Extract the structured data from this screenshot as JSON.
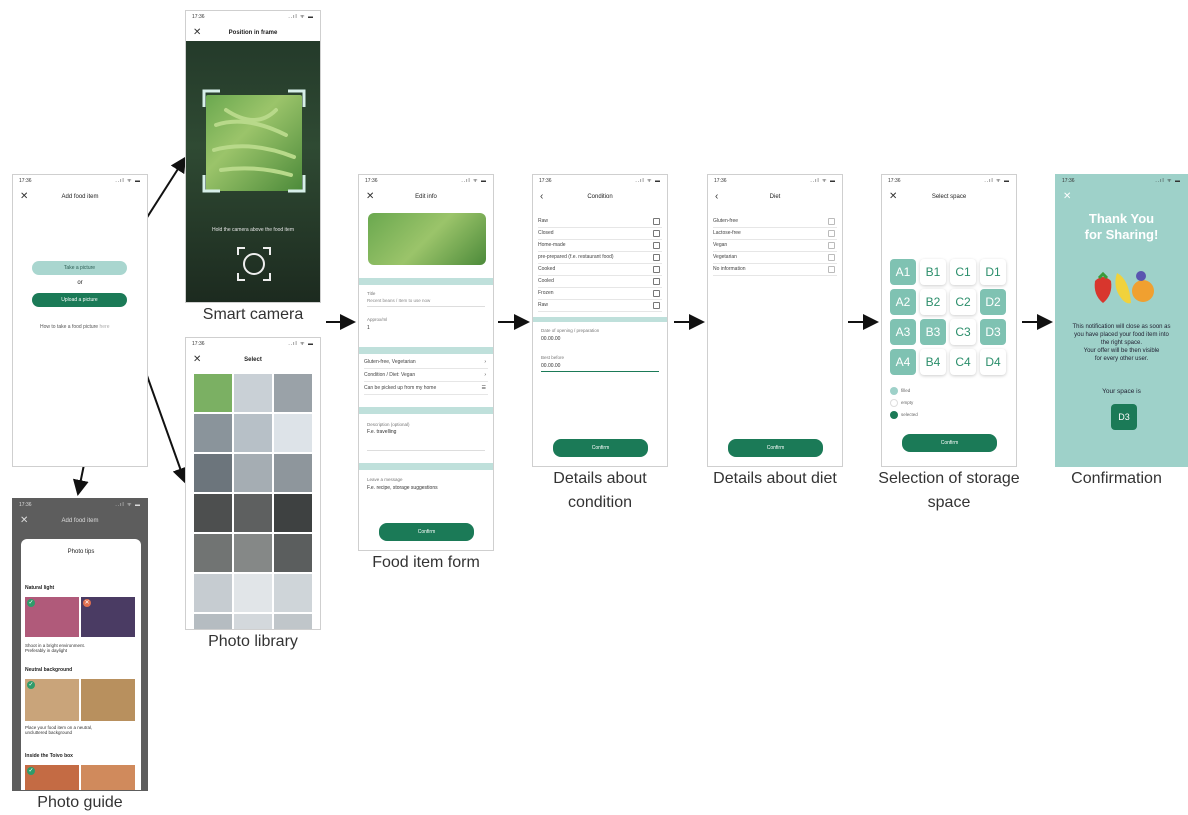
{
  "captions": {
    "smart_camera": "Smart camera",
    "photo_library": "Photo library",
    "photo_guide": "Photo guide",
    "food_form": "Food item form",
    "condition": "Details about condition",
    "diet": "Details about diet",
    "storage": "Selection of storage space",
    "confirmation": "Confirmation"
  },
  "status_time": "17:36",
  "status_icons": "..ıl ᯤ ▬",
  "add_food": {
    "title": "Add food item",
    "take_picture": "Take a picture",
    "or": "or",
    "upload": "Upload a picture",
    "howto": "How to take a food picture",
    "howto_link": "here"
  },
  "camera": {
    "title": "Position in frame",
    "hint": "Hold the camera above the food item"
  },
  "library": {
    "title": "Select"
  },
  "guide": {
    "bg_title": "Add food item",
    "card_title": "Photo tips",
    "s1": "Natural light",
    "s1_text1": "Shoot in a bright environment.",
    "s1_text2": "Preferably in daylight",
    "s2": "Neutral background",
    "s2_text1": "Place your food item on a neutral,",
    "s2_text2": "uncluttered background",
    "s3": "Inside the Toivo box"
  },
  "form": {
    "title": "Edit info",
    "title_label": "Title",
    "title_placeholder": "Recent beans / Item to use now",
    "amount_label": "Approx/ml",
    "amount_value": "1",
    "diet1": "Gluten-free, Vegetarian",
    "diet2": "Condition / Diet: Vegan",
    "pickup": "Can be picked up from my home",
    "desc_label": "Description (optional)",
    "desc_value": "F.e. travelling",
    "msg_label": "Leave a message",
    "msg_value": "F.e. recipe, storage suggestions",
    "confirm": "Confirm"
  },
  "condition": {
    "title": "Condition",
    "items": [
      "Raw",
      "Closed",
      "Home-made",
      "pre-prepared (f.e. restaurant food)",
      "Cooked",
      "Cooled",
      "Frozen",
      "Raw"
    ],
    "date_label": "Date of opening / preparation",
    "date_value": "00.00.00",
    "best_label": "Best before",
    "best_value": "00.00.00",
    "confirm": "Confirm"
  },
  "diet": {
    "title": "Diet",
    "items": [
      "Gluten-free",
      "Lactose-free",
      "Vegan",
      "Vegetarian",
      "No information"
    ],
    "confirm": "Confirm"
  },
  "storage": {
    "title": "Select space",
    "rows": [
      [
        "A1",
        "B1",
        "C1",
        "D1"
      ],
      [
        "A2",
        "B2",
        "C2",
        "D2"
      ],
      [
        "A3",
        "B3",
        "C3",
        "D3"
      ],
      [
        "A4",
        "B4",
        "C4",
        "D4"
      ]
    ],
    "legend": [
      "filled",
      "empty",
      "selected"
    ],
    "confirm": "Confirm"
  },
  "confirmation": {
    "title1": "Thank You",
    "title2": "for Sharing!",
    "text1": "This notification will close as soon as",
    "text2": "you have placed your food item into",
    "text3": "the right space.",
    "text4": "Your offer will be then visible",
    "text5": "for every other user.",
    "space_label": "Your space is",
    "space_value": "D3"
  },
  "colors": {
    "green": "#1b7a57",
    "mint": "#9fd1c8",
    "light_mint": "#bfe0db",
    "confirm_bg": "#9ed1c9"
  }
}
